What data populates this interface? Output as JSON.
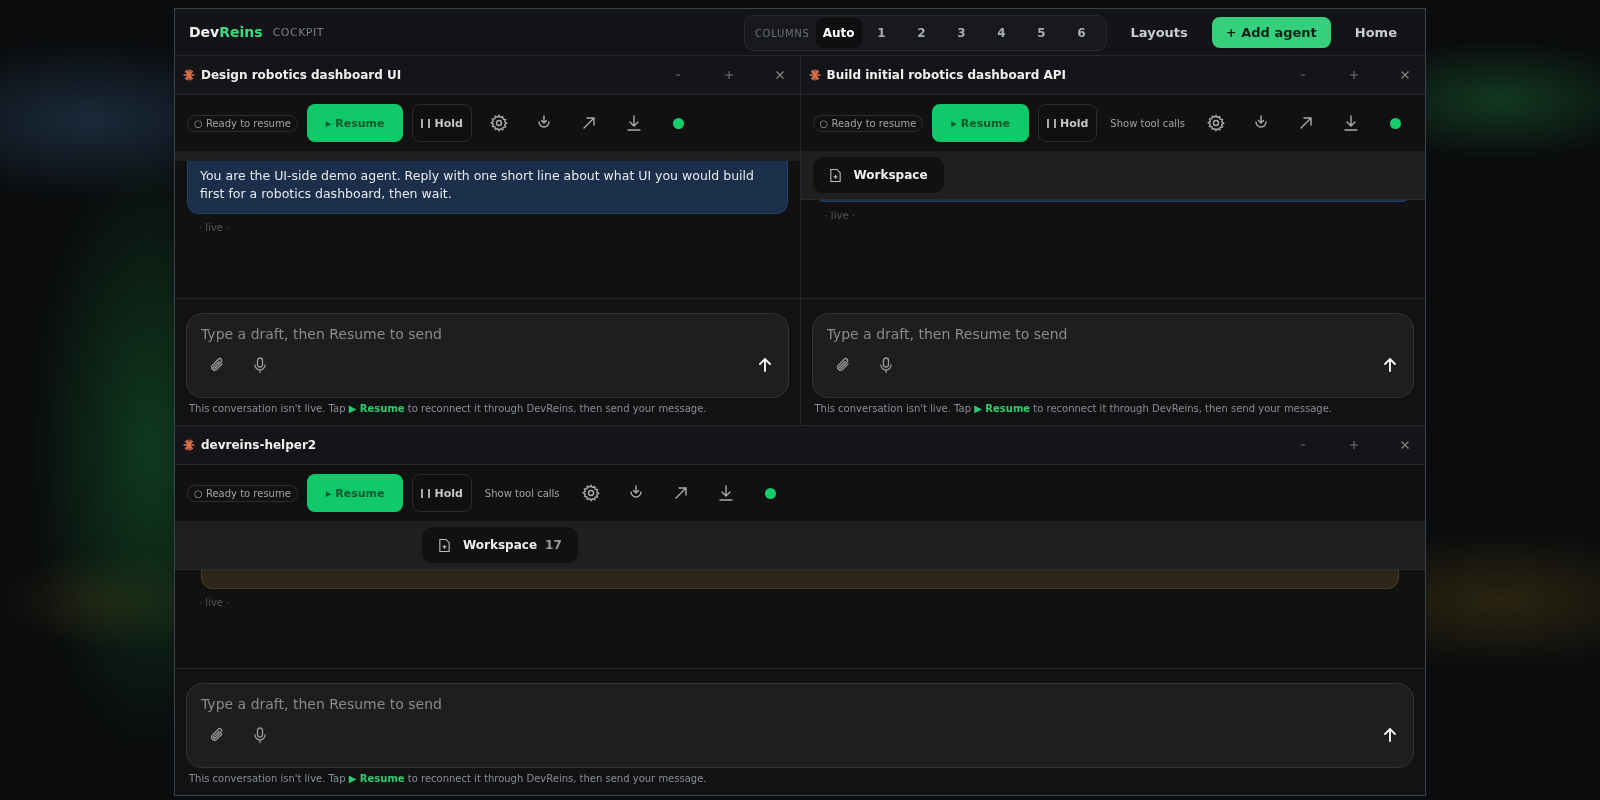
{
  "brand": {
    "name_first": "Dev",
    "name_second": "Reins",
    "subtitle": "COCKPIT"
  },
  "columns": {
    "label": "COLUMNS",
    "options": [
      {
        "label": "Auto",
        "selected": true
      },
      {
        "label": "1",
        "selected": false
      },
      {
        "label": "2",
        "selected": false
      },
      {
        "label": "3",
        "selected": false
      },
      {
        "label": "4",
        "selected": false
      },
      {
        "label": "5",
        "selected": false
      },
      {
        "label": "6",
        "selected": false
      }
    ]
  },
  "nav": [
    {
      "label": "Layouts",
      "kind": "link"
    },
    {
      "label": "+ Add agent",
      "kind": "primary"
    },
    {
      "label": "Home",
      "kind": "link"
    }
  ],
  "rows": [
    [
      {
        "title": "Design robotics dashboard UI",
        "status": "○ Ready to resume",
        "resume": "▸ Resume",
        "hold": "Hold",
        "connected": true,
        "message": {
          "kind": "user",
          "text": "You are the UI-side demo agent. Reply with one short line about what UI you would build first for a robotics dashboard, then wait."
        },
        "live": "· live ·",
        "composer": {
          "placeholder": "Type a draft, then Resume to send",
          "hint": "This conversation isn't live. Tap **▶ Resume** to reconnect it through DevReins, then send your message."
        }
      },
      {
        "title": "Build initial robotics dashboard API",
        "status": "○ Ready to resume",
        "resume": "▸ Resume",
        "hold": "Hold",
        "show_tool_calls": "Show tool calls",
        "connected": true,
        "workspace": {
          "label": "Workspace"
        },
        "message": {
          "kind": "user"
        },
        "live": "· live ·",
        "composer": {
          "placeholder": "Type a draft, then Resume to send",
          "hint": "This conversation isn't live. Tap **▶ Resume** to reconnect it through DevReins, then send your message."
        }
      }
    ],
    [
      {
        "title": "devreins-helper2",
        "status": "○ Ready to resume",
        "resume": "▸ Resume",
        "hold": "Hold",
        "show_tool_calls": "Show tool calls",
        "connected": true,
        "workspace": {
          "label": "Workspace",
          "count": "17"
        },
        "message": {
          "kind": "tool"
        },
        "live": "· live ·",
        "composer": {
          "placeholder": "Type a draft, then Resume to send",
          "hint": "This conversation isn't live. Tap **▶ Resume** to reconnect it through DevReins, then send your message."
        }
      }
    ]
  ]
}
